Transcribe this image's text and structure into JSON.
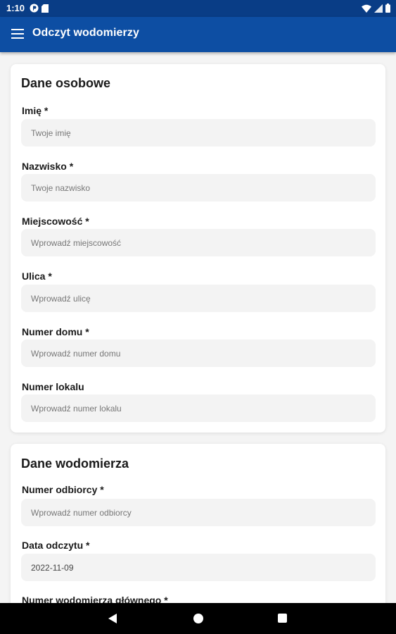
{
  "status_bar": {
    "time": "1:10"
  },
  "app_bar": {
    "title": "Odczyt wodomierzy"
  },
  "personal": {
    "heading": "Dane osobowe",
    "fields": [
      {
        "label": "Imię *",
        "placeholder": "Twoje imię"
      },
      {
        "label": "Nazwisko *",
        "placeholder": "Twoje nazwisko"
      },
      {
        "label": "Miejscowość *",
        "placeholder": "Wprowadź miejscowość"
      },
      {
        "label": "Ulica *",
        "placeholder": "Wprowadź ulicę"
      },
      {
        "label": "Numer domu *",
        "placeholder": "Wprowadź numer domu"
      },
      {
        "label": "Numer lokalu",
        "placeholder": "Wprowadź numer lokalu"
      }
    ]
  },
  "meter": {
    "heading": "Dane wodomierza",
    "fields": [
      {
        "label": "Numer odbiorcy *",
        "placeholder": "Wprowadź numer odbiorcy",
        "value": ""
      },
      {
        "label": "Data odczytu *",
        "placeholder": "",
        "value": "2022-11-09"
      },
      {
        "label": "Numer wodomierza głównego *"
      }
    ]
  }
}
